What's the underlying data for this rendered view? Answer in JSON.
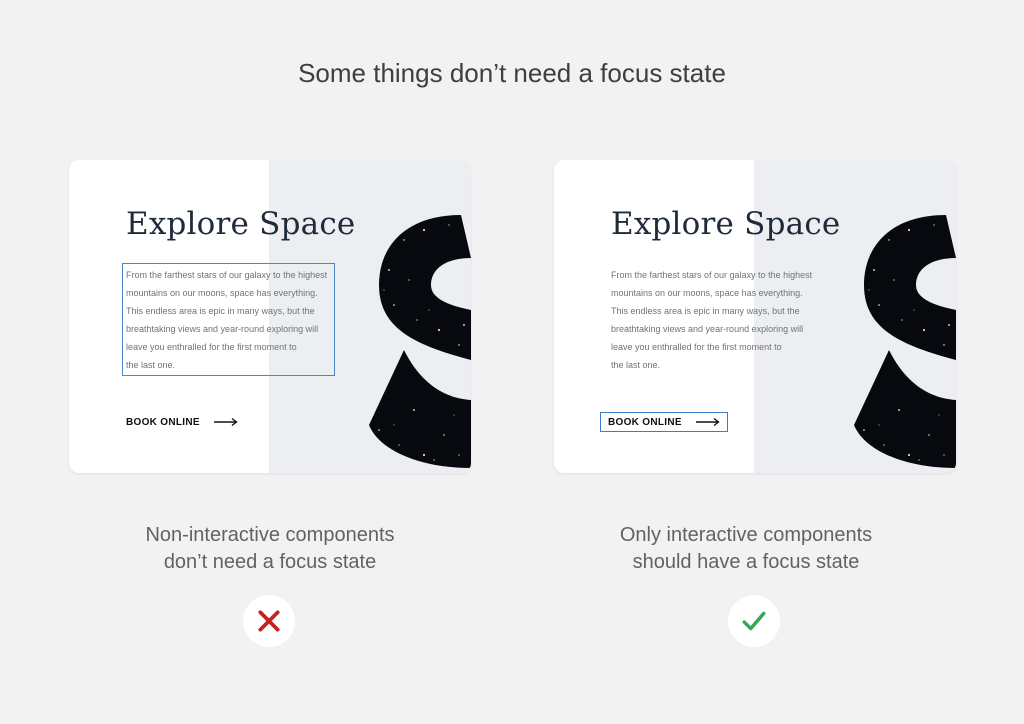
{
  "title": "Some things don’t need a focus state",
  "card": {
    "heading": "Explore Space",
    "body_lines": [
      "From the farthest stars of our galaxy to the highest",
      "mountains on our moons, space has everything.",
      "This endless area is epic in many ways, but the",
      "breathtaking views and year-round exploring will",
      "leave you enthralled for the first moment to",
      "the last one."
    ],
    "cta_label": "BOOK ONLINE"
  },
  "examples": [
    {
      "caption_lines": [
        "Non-interactive components",
        "don’t need a focus state"
      ],
      "verdict_icon": "x-icon",
      "verdict_color": "#c5221f",
      "focused": "body-text"
    },
    {
      "caption_lines": [
        "Only interactive components",
        "should have a focus state"
      ],
      "verdict_icon": "checkmark-icon",
      "verdict_color": "#34a853",
      "focused": "book-online-button"
    }
  ],
  "colors": {
    "background": "#f2f2f2",
    "focus_ring": "#4a86c8",
    "heading": "#1f2a3a"
  }
}
